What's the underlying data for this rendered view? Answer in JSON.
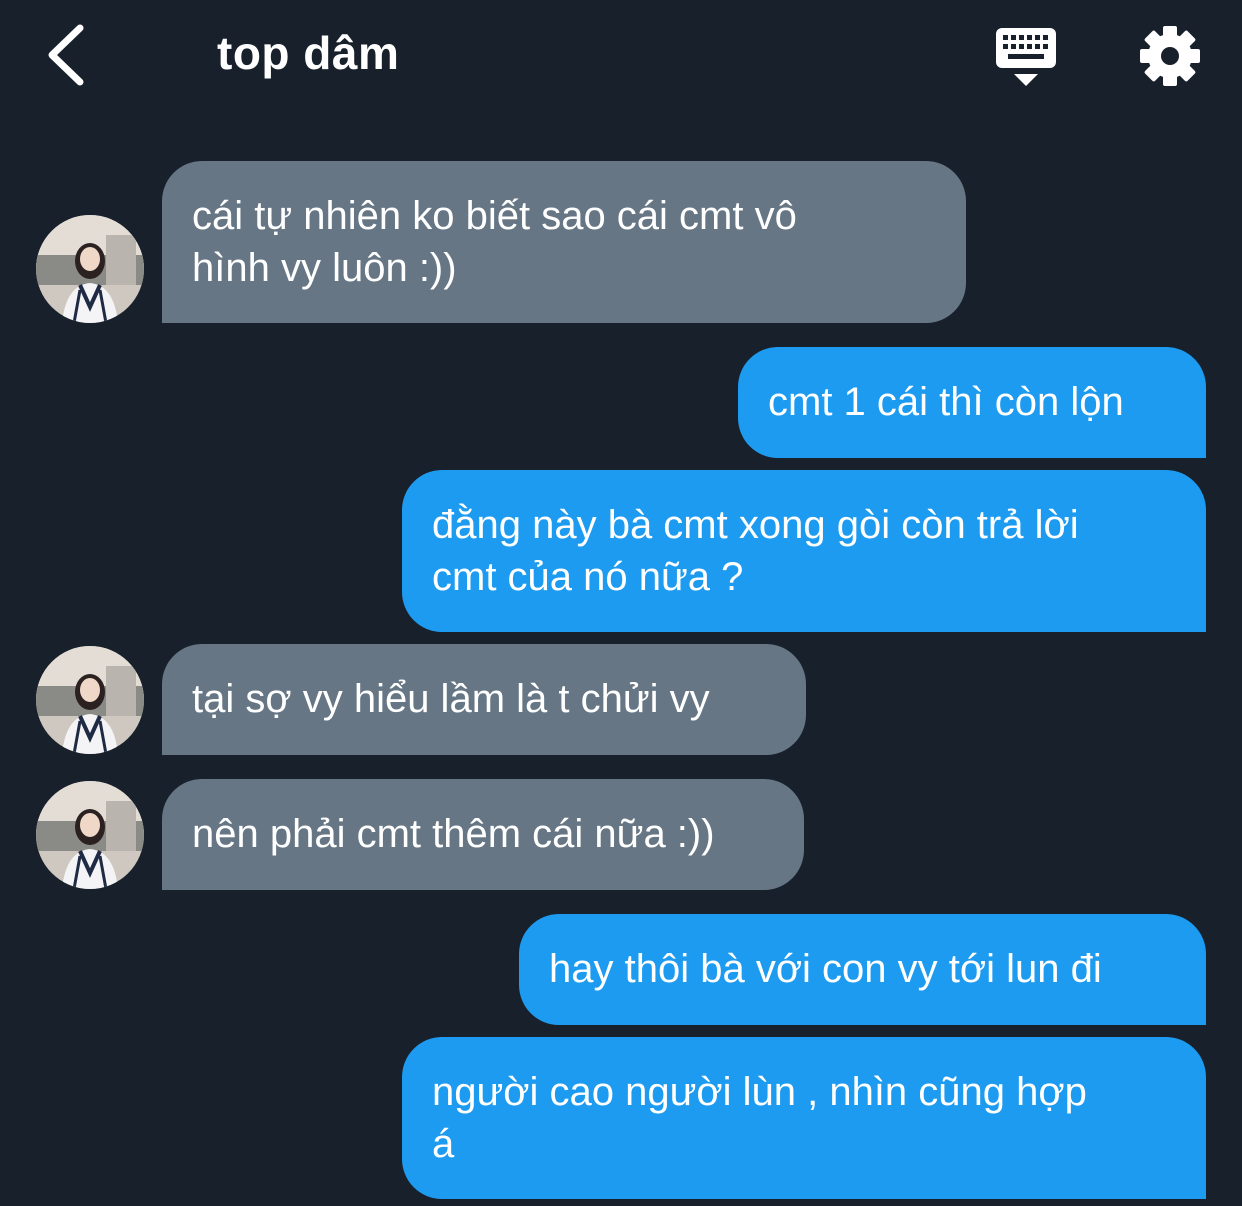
{
  "header": {
    "back_icon": "chevron-left-icon",
    "title": "top dâm",
    "keyboard_icon": "keyboard-icon",
    "settings_icon": "gear-icon"
  },
  "colors": {
    "background": "#17202b",
    "incoming_bubble": "#667685",
    "outgoing_bubble": "#1d9bf0",
    "text": "#ffffff"
  },
  "messages": [
    {
      "direction": "incoming",
      "text": "cái tự nhiên ko biết sao cái cmt vô\nhình vy luôn :))",
      "avatar": "avatar"
    },
    {
      "direction": "outgoing",
      "text": "cmt 1 cái thì còn lộn"
    },
    {
      "direction": "outgoing",
      "text": "đằng này bà cmt xong gòi còn trả lời\ncmt của nó nữa ?"
    },
    {
      "direction": "incoming",
      "text": "tại sợ vy hiểu lầm là t chửi vy",
      "avatar": "avatar"
    },
    {
      "direction": "incoming",
      "text": "nên phải cmt thêm cái nữa :))",
      "avatar": "avatar"
    },
    {
      "direction": "outgoing",
      "text": "hay thôi bà với con vy tới lun đi"
    },
    {
      "direction": "outgoing",
      "text": "người cao người lùn , nhìn cũng hợp\ná"
    }
  ]
}
